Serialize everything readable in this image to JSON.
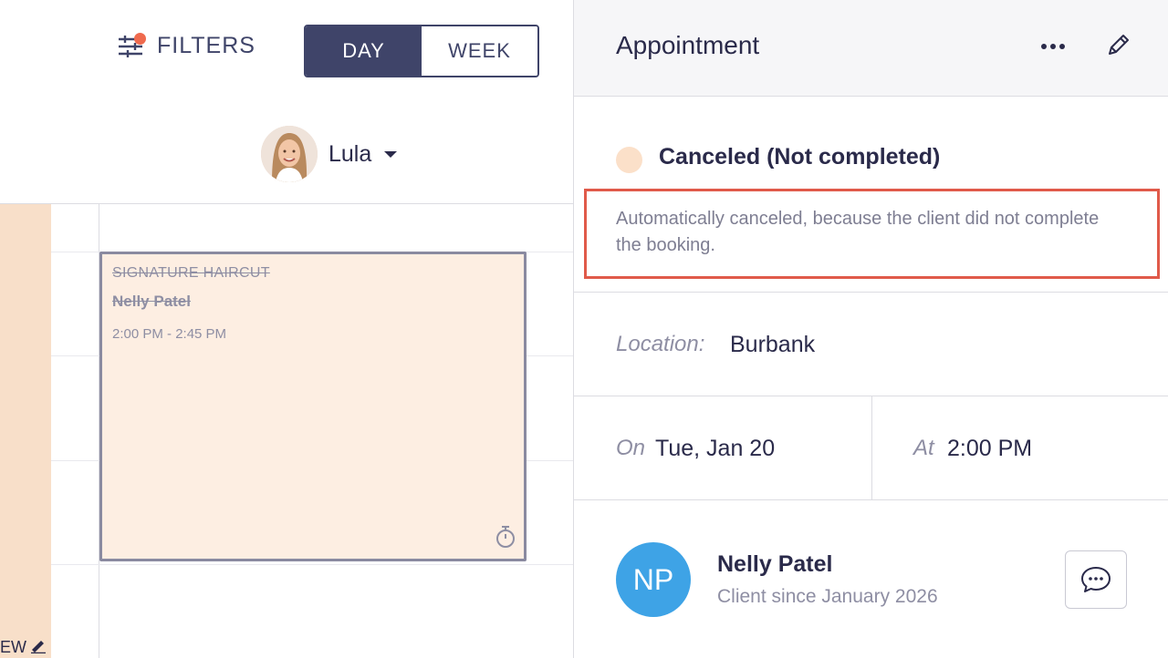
{
  "toolbar": {
    "filters_label": "FILTERS",
    "view_day": "DAY",
    "view_week": "WEEK",
    "selected_view": "DAY"
  },
  "staff": {
    "name": "Lula"
  },
  "calendar_appointment": {
    "service": "SIGNATURE HAIRCUT",
    "client": "Nelly Patel",
    "time": "2:00 PM - 2:45 PM"
  },
  "left_strip": {
    "label": "EW"
  },
  "panel": {
    "title": "Appointment",
    "status": "Canceled (Not completed)",
    "cancel_note": "Automatically canceled, because the client did not complete the booking.",
    "location_label": "Location:",
    "location_value": "Burbank",
    "date_label": "On",
    "date_value": "Tue, Jan 20",
    "time_label": "At",
    "time_value": "2:00 PM",
    "client_initials": "NP",
    "client_name": "Nelly Patel",
    "client_since": "Client since January 2026"
  },
  "colors": {
    "primary": "#3f4469",
    "notification_dot": "#ef6a4e",
    "canceled_block": "#fdeee2",
    "status_dot": "#fbe0c9",
    "highlight_border": "#e05a4a",
    "client_avatar": "#3ea3e6"
  },
  "icons": [
    "sliders-icon",
    "chevron-down-icon",
    "timer-icon",
    "pencil-icon",
    "more-horizontal-icon",
    "edit-icon",
    "chat-icon"
  ]
}
